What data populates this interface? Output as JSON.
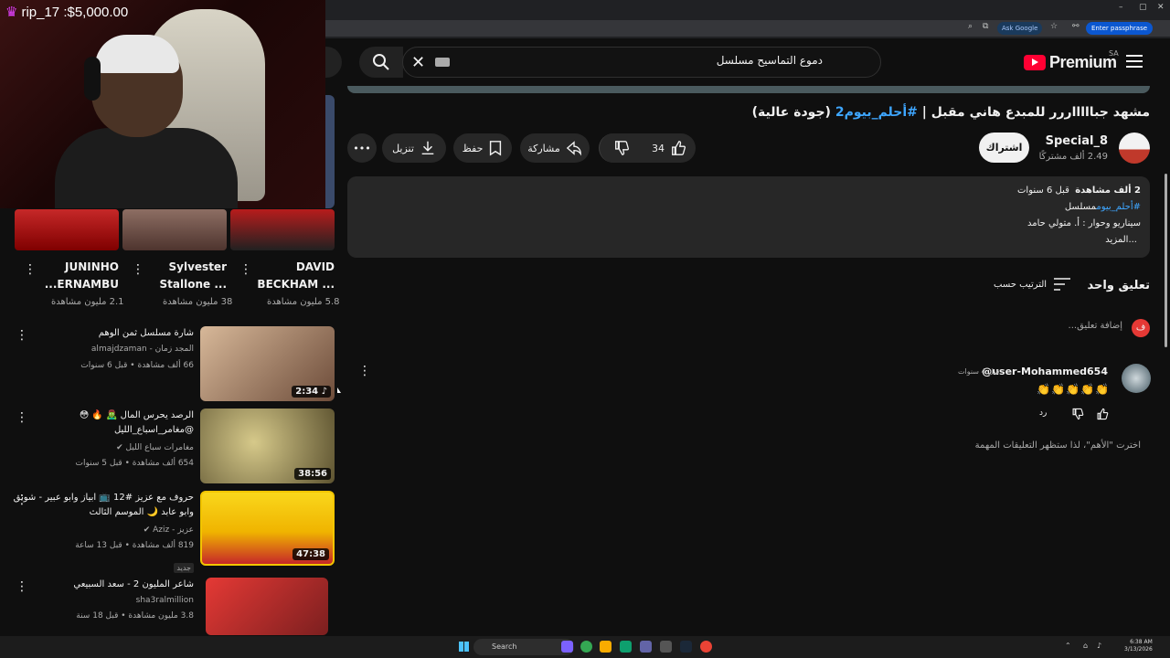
{
  "browser": {
    "ask_google": "Ask Google",
    "passphrase": "Enter passphrase",
    "window_controls": [
      "–",
      "▢",
      "✕"
    ]
  },
  "header": {
    "search_query": "دموع التماسيح مسلسل",
    "logo_text": "Premium",
    "region": "SA"
  },
  "video": {
    "title_part1": "مشهد جباااااررر للمبدع هاني مقبل | ",
    "title_hashtag": "#أحلم_بيوم2",
    "title_part2": " (جودة عالية)",
    "channel": "Special_8",
    "subscribers": "2.49 ألف مشتركًا",
    "subscribe": "اشتراك",
    "likes": "34",
    "share": "مشاركة",
    "save": "حفظ",
    "download": "تنزيل",
    "more": "•••"
  },
  "description": {
    "views": "2 ألف مشاهدة",
    "age": "قبل 6 سنوات",
    "hashtag": "#أحلم_بيوم",
    "tag_text": "مسلسل",
    "line3": "سيناريو وحوار : أ. متولي حامد",
    "more": "...المزيد"
  },
  "comments": {
    "title": "تعليق واحد",
    "sort": "الترتيب حسب",
    "me_initial": "ف",
    "add_placeholder": "إضافة تعليق...",
    "items": [
      {
        "author": "@user-Mohammed654",
        "time": "قبل 4 سنوات",
        "text": "👏👏👏👏👏",
        "reply": "رد"
      }
    ],
    "sort_note": "اخترت \"الأهم\"، لذا ستظهر التعليقات المهمة"
  },
  "stream": {
    "donation": "rip_17 :$5,000.00"
  },
  "shorts": [
    {
      "title_line1": "JUNINHO",
      "title_line2": "...ERNAMBU",
      "views": "2.1 مليون مشاهدة"
    },
    {
      "title_line1": "Sylvester",
      "title_line2": "Stallone ...",
      "views": "38 مليون مشاهدة"
    },
    {
      "title_line1": "DAVID",
      "title_line2": "BECKHAM ...",
      "views": "5.8 مليون مشاهدة"
    }
  ],
  "recommended": [
    {
      "title": "شارة مسلسل ثمن الوهم",
      "channel": "المجد زمان - almajdzaman",
      "meta": "66 ألف مشاهدة • قبل 6 سنوات",
      "duration": "2:34 ♪",
      "colors": [
        "#c9a98c",
        "#7b5a44"
      ]
    },
    {
      "title": "الرصد يحرس المال 🧟‍♂️ 🔥 😳 @مغامر_اسباع_الليل",
      "channel": "مغامرات سباع الليل ✔",
      "meta": "654 ألف مشاهدة • قبل 5 سنوات",
      "duration": "38:56",
      "colors": [
        "#a89a5c",
        "#4d4428"
      ]
    },
    {
      "title": "حروف مع عزيز #12 📺 ابياز وابو عبير - شونق وابو عابد 🌙 الموسم الثالث",
      "channel": "عزيز - Aziz ✔",
      "meta": "819 ألف مشاهدة • قبل 13 ساعة",
      "badge": "جديد",
      "duration": "47:38",
      "colors": [
        "#f2c500",
        "#b71c1c"
      ]
    },
    {
      "title": "شاعر المليون 2 - سعد السبيعي",
      "channel": "sha3ralmillion",
      "meta": "3.8 مليون مشاهدة • قبل 18 سنة",
      "duration": "",
      "colors": [
        "#d32f2f",
        "#7b1f1f"
      ]
    }
  ],
  "taskbar": {
    "search": "Search",
    "time": "6:38 AM",
    "date": "3/13/2026"
  }
}
